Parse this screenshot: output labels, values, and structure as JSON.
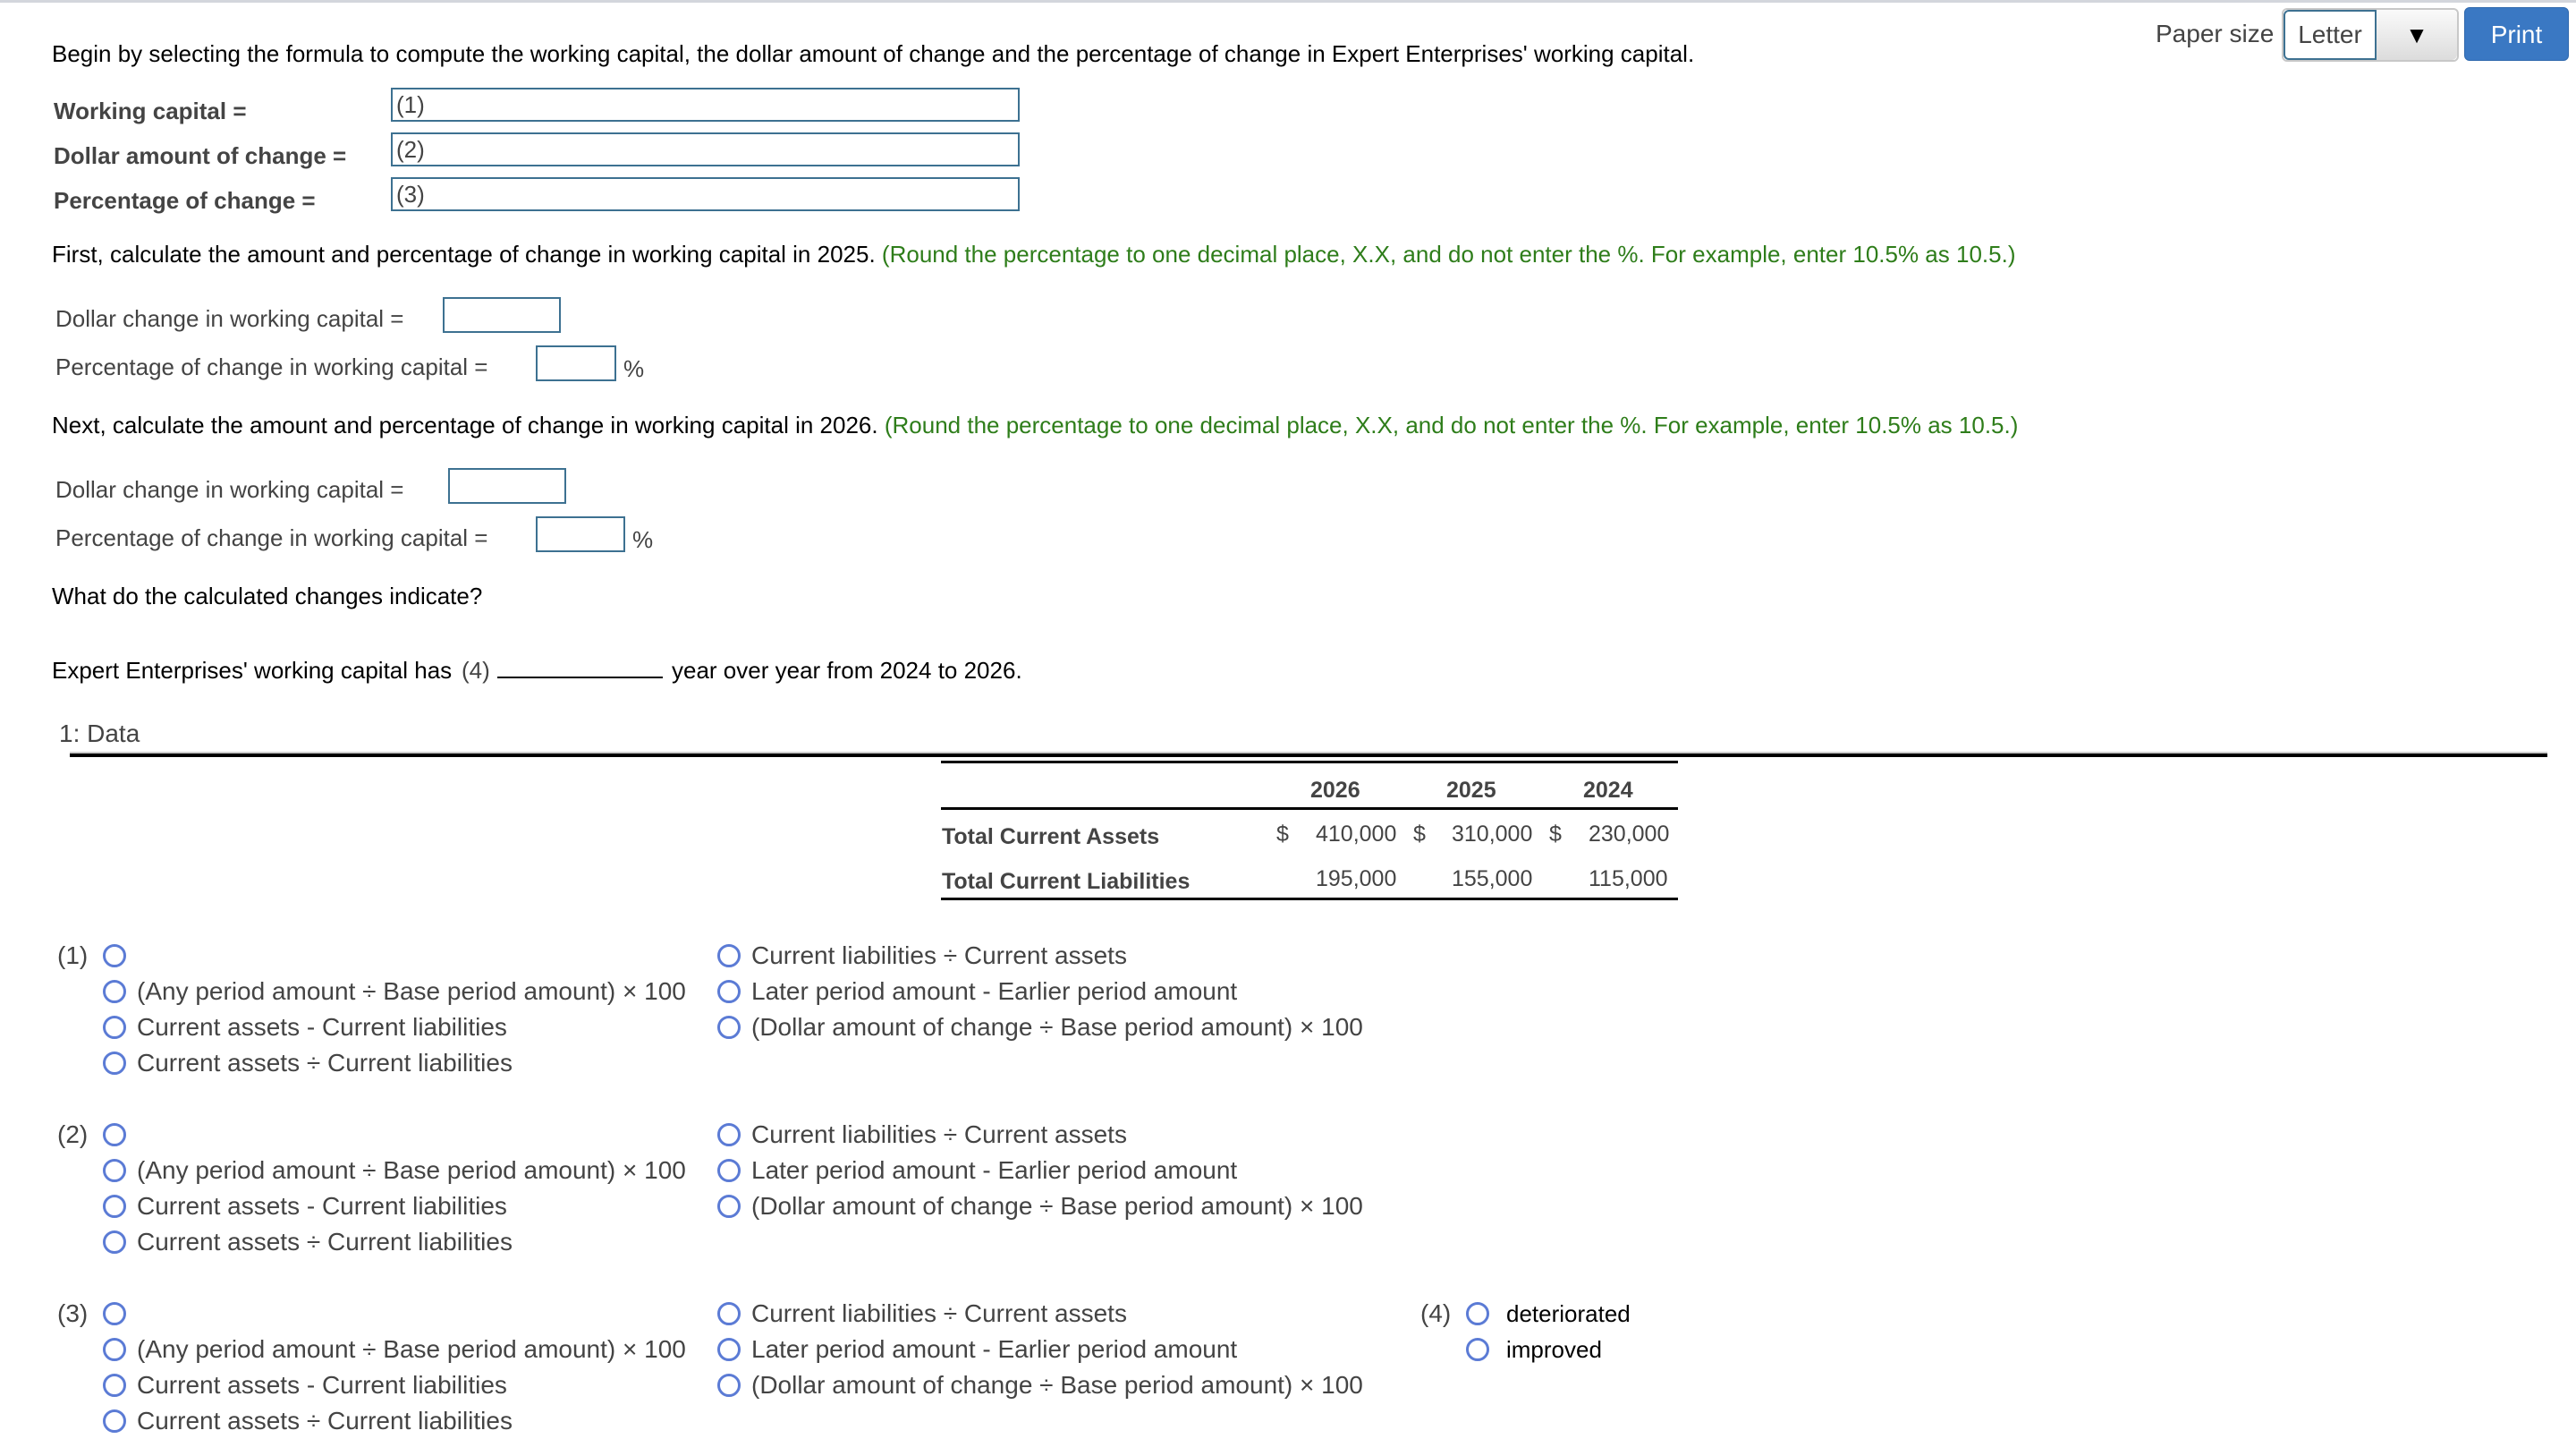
{
  "header": {
    "paper_size_label": "Paper size",
    "paper_size_value": "Letter",
    "dropdown_arrow": "▼",
    "print_label": "Print"
  },
  "intro": "Begin by selecting the formula to compute the working capital, the dollar amount of change and the percentage of change in Expert Enterprises' working capital.",
  "formulas": [
    {
      "label": "Working capital =",
      "value": "(1)"
    },
    {
      "label": "Dollar amount of change =",
      "value": "(2)"
    },
    {
      "label": "Percentage of change =",
      "value": "(3)"
    }
  ],
  "section_2025": {
    "instruction": "First, calculate the amount and percentage of change in working capital in 2025.",
    "hint": "(Round the percentage to one decimal place, X.X, and do not enter the %. For example, enter 10.5% as 10.5.)",
    "dollar_label": "Dollar change in working capital =",
    "dollar_value": "",
    "percent_label": "Percentage of change in working capital =",
    "percent_value": "",
    "percent_sign": "%"
  },
  "section_2026": {
    "instruction": "Next, calculate the amount and percentage of change in working capital in 2026.",
    "hint": "(Round the percentage to one decimal place, X.X, and do not enter the %. For example, enter 10.5% as 10.5.)",
    "dollar_label": "Dollar change in working capital =",
    "dollar_value": "",
    "percent_label": "Percentage of change in working capital =",
    "percent_value": "",
    "percent_sign": "%"
  },
  "question": "What do the calculated changes indicate?",
  "conclusion": {
    "prefix": "Expert Enterprises' working capital has",
    "marker": "(4)",
    "suffix": "year over year from 2024 to 2026."
  },
  "data_section": {
    "title": "1: Data",
    "columns": [
      "2026",
      "2025",
      "2024"
    ],
    "rows": [
      {
        "label": "Total Current Assets",
        "currency": [
          "$",
          "$",
          "$"
        ],
        "values": [
          "410,000",
          "310,000",
          "230,000"
        ]
      },
      {
        "label": "Total Current Liabilities",
        "currency": [
          "",
          "",
          ""
        ],
        "values": [
          "195,000",
          "155,000",
          "115,000"
        ]
      }
    ]
  },
  "options_formula": {
    "groups": [
      "(1)",
      "(2)",
      "(3)"
    ],
    "left": [
      "(Any period amount ÷ Base period amount) × 100",
      "Current assets - Current liabilities",
      "Current assets ÷ Current liabilities"
    ],
    "right": [
      "Current liabilities ÷ Current assets",
      "Later period amount - Earlier period amount",
      "(Dollar amount of change ÷ Base period amount) × 100"
    ]
  },
  "options_4": {
    "label": "(4)",
    "choices": [
      "deteriorated",
      "improved"
    ]
  }
}
